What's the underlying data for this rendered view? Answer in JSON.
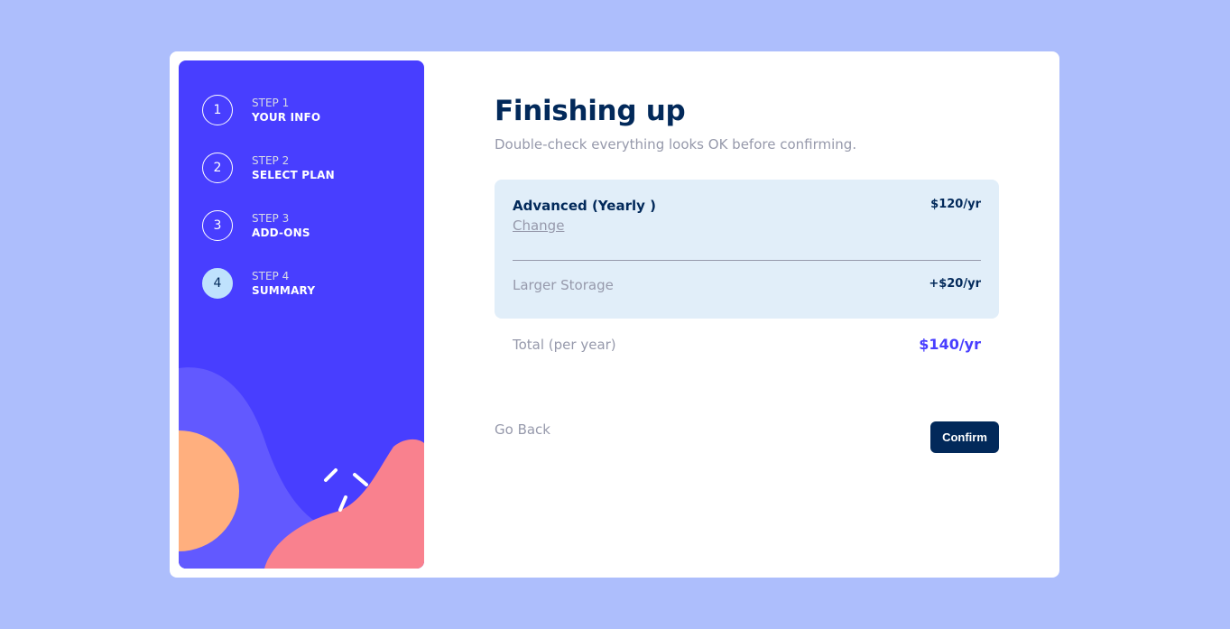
{
  "sidebar": {
    "steps": [
      {
        "number": "1",
        "kicker": "STEP 1",
        "title": "YOUR INFO",
        "active": false
      },
      {
        "number": "2",
        "kicker": "STEP 2",
        "title": "SELECT PLAN",
        "active": false
      },
      {
        "number": "3",
        "kicker": "STEP 3",
        "title": "ADD-ONS",
        "active": false
      },
      {
        "number": "4",
        "kicker": "STEP 4",
        "title": "SUMMARY",
        "active": true
      }
    ]
  },
  "main": {
    "title": "Finishing up",
    "subtitle": "Double-check everything looks OK before confirming.",
    "plan": {
      "name": "Advanced (Yearly )",
      "change_label": "Change",
      "price": "$120/yr"
    },
    "addons": [
      {
        "name": "Larger Storage",
        "price": "+$20/yr"
      }
    ],
    "total": {
      "label": "Total (per year)",
      "price": "$140/yr"
    },
    "buttons": {
      "back_label": "Go Back",
      "confirm_label": "Confirm"
    }
  },
  "colors": {
    "page_background": "#adbefc",
    "sidebar_background": "#483eff",
    "marine_blue": "#02295a",
    "purplish_blue": "#483eff",
    "cool_gray": "#9699ab",
    "light_blue": "#bfe2fd",
    "summary_background": "#e1eef9",
    "blob_purple": "#6259ff",
    "blob_orange": "#ffaf7e",
    "blob_pink": "#f9818e"
  }
}
